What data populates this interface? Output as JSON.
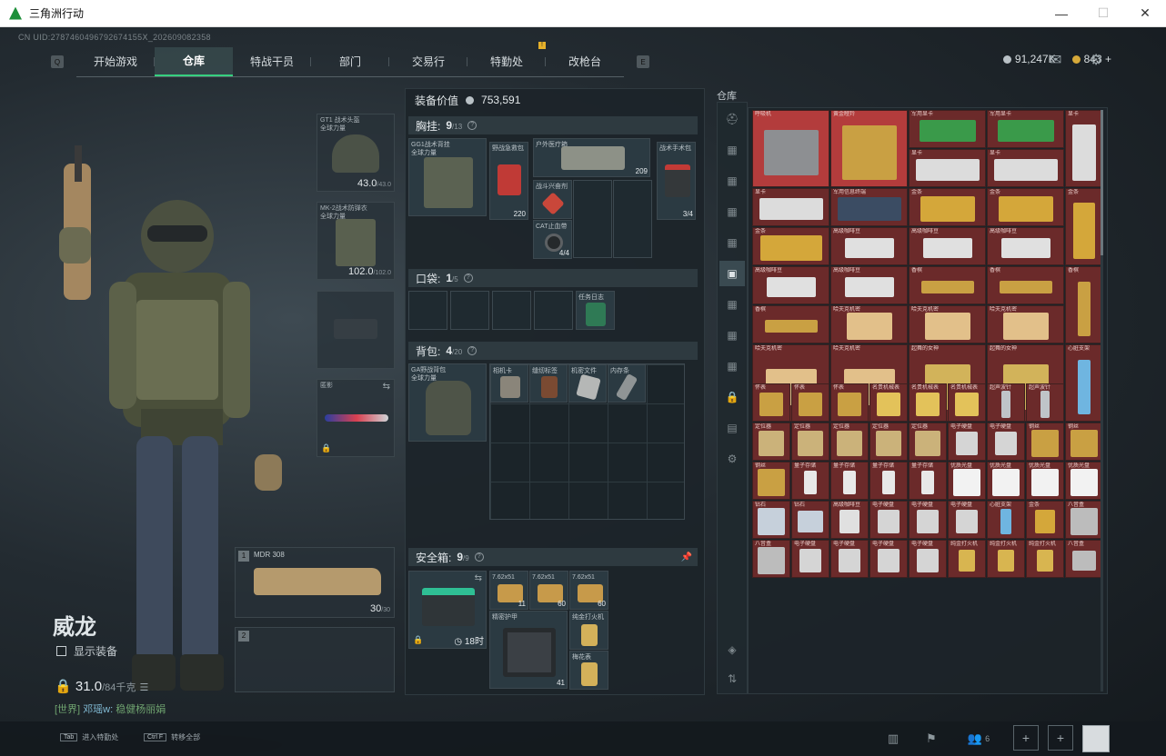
{
  "window": {
    "title": "三角洲行动",
    "minimize": "—",
    "maximize": "☐",
    "close": "✕"
  },
  "uid": "CN UID:2787460496792674155Ⅹ_2026090823​58",
  "nav": {
    "tabs": [
      {
        "label": "开始游戏"
      },
      {
        "label": "仓库",
        "active": true
      },
      {
        "label": "特战干员"
      },
      {
        "label": "部门"
      },
      {
        "label": "交易行"
      },
      {
        "label": "特勤处",
        "badge": "!"
      },
      {
        "label": "改枪台"
      }
    ],
    "left_key": "Q",
    "right_key": "E"
  },
  "currency": {
    "silver": "91,247K",
    "gold": "843",
    "plus": "+"
  },
  "character": {
    "name": "威龙",
    "show_equipment": "显示装备",
    "weight": "31.0",
    "weight_max": "/84千克",
    "chat_channel": "[世界]",
    "chat_text": "稳健杨丽娟",
    "chat_user": "邓瑶w: "
  },
  "equipment": {
    "helmet": {
      "label": "GT1 战术头盔",
      "sub": "全球力量",
      "dur": "43.0",
      "dur_max": "/43.0"
    },
    "armor": {
      "label": "MK-2战术防弹衣",
      "sub": "全球力量",
      "dur": "102.0",
      "dur_max": "/102.0"
    },
    "melee": {
      "label": "匿影"
    }
  },
  "weapons": [
    {
      "num": "1",
      "label": "MDR 308",
      "ammo": "30",
      "ammo_max": "/30"
    },
    {
      "num": "2",
      "label": ""
    }
  ],
  "loadout": {
    "value_label": "装备价值",
    "value": "753,591",
    "chest": {
      "title": "胸挂:",
      "count": "9",
      "cap": "/13",
      "rig": "GG1战术背挂",
      "rig_sub": "全球力量",
      "items": [
        {
          "name": "野战急救包",
          "val": "220"
        },
        {
          "name": "户外医疗箱",
          "val": "209"
        },
        {
          "name": "战术手术包",
          "val": "3/4"
        },
        {
          "name": "战斗兴奋剂",
          "val": ""
        },
        {
          "name": "CAT止血带",
          "val": "4/4"
        }
      ]
    },
    "pocket": {
      "title": "口袋:",
      "count": "1",
      "cap": "/5",
      "items": [
        {
          "name": "任务日志"
        }
      ]
    },
    "backpack": {
      "title": "背包:",
      "count": "4",
      "cap": "/20",
      "bag": "GA野战背包",
      "bag_sub": "全球力量",
      "items": [
        {
          "name": "相机卡"
        },
        {
          "name": "缝纫标签"
        },
        {
          "name": "机密文件"
        },
        {
          "name": "内存条"
        }
      ]
    },
    "safe": {
      "title": "安全箱:",
      "count": "9",
      "cap": "/9",
      "timer": "18时",
      "items": [
        {
          "name": "7.62x51",
          "val": "11"
        },
        {
          "name": "7.62x51",
          "val": "60"
        },
        {
          "name": "7.62x51",
          "val": "60"
        },
        {
          "name": "精密护甲",
          "val": "41"
        },
        {
          "name": "纯金打火机",
          "val": ""
        },
        {
          "name": "梅花表",
          "val": ""
        }
      ]
    }
  },
  "stash": {
    "title": "仓库",
    "cells": [
      {
        "name": "呼吸机",
        "color": "#b33c3c",
        "icon_color": "#8d8f92"
      },
      {
        "name": "黄金瞪羚",
        "color": "#b33c3c",
        "icon_color": "#c9a043"
      },
      {
        "name": "军用显卡",
        "color": "#6b2a2a",
        "icon_color": "#3a9a4a"
      },
      {
        "name": "军用显卡",
        "color": "#6b2a2a",
        "icon_color": "#3a9a4a"
      },
      {
        "name": "显卡",
        "color": "#6b2a2a",
        "icon_color": "#dcdcdc"
      },
      {
        "name": "显卡",
        "color": "#6b2a2a",
        "icon_color": "#dcdcdc"
      },
      {
        "name": "显卡",
        "color": "#6b2a2a",
        "icon_color": "#dcdcdc"
      },
      {
        "name": "军用信息终端",
        "color": "#6b2a2a",
        "icon_color": "#3b4c63"
      },
      {
        "name": "金条",
        "color": "#6b2a2a",
        "icon_color": "#d4a73a"
      },
      {
        "name": "金条",
        "color": "#6b2a2a",
        "icon_color": "#d4a73a"
      },
      {
        "name": "金条",
        "color": "#6b2a2a",
        "icon_color": "#d4a73a"
      },
      {
        "name": "金条",
        "color": "#6b2a2a",
        "icon_color": "#d4a73a"
      },
      {
        "name": "高级咖啡豆",
        "color": "#6b2a2a",
        "icon_color": "#e0e0e0"
      },
      {
        "name": "高级咖啡豆",
        "color": "#6b2a2a",
        "icon_color": "#e0e0e0"
      },
      {
        "name": "高级咖啡豆",
        "color": "#6b2a2a",
        "icon_color": "#e0e0e0"
      },
      {
        "name": "香槟",
        "color": "#6b2a2a",
        "icon_color": "#c9a043"
      },
      {
        "name": "哈夫克机密",
        "color": "#6b2a2a",
        "icon_color": "#e2c08a"
      },
      {
        "name": "起舞的女神",
        "color": "#6b2a2a",
        "icon_color": "#d2b35a"
      },
      {
        "name": "心脏支架",
        "color": "#6b2a2a",
        "icon_color": "#6fb5e0"
      },
      {
        "name": "怀表",
        "color": "#6b2a2a",
        "icon_color": "#c9a043"
      },
      {
        "name": "名贵机械表",
        "color": "#6b2a2a",
        "icon_color": "#e3c25a"
      },
      {
        "name": "超声波针",
        "color": "#6b2a2a",
        "icon_color": "#bfc4c8"
      },
      {
        "name": "定位器",
        "color": "#6b2a2a",
        "icon_color": "#cbb27a"
      },
      {
        "name": "电子硬盘",
        "color": "#6b2a2a",
        "icon_color": "#d5d5d5"
      },
      {
        "name": "钢丝",
        "color": "#6b2a2a",
        "icon_color": "#c9a043"
      },
      {
        "name": "量子存储",
        "color": "#6b2a2a",
        "icon_color": "#e8e8e8"
      },
      {
        "name": "优质光盘",
        "color": "#6b2a2a",
        "icon_color": "#f2f2f2"
      },
      {
        "name": "钻石",
        "color": "#6b2a2a",
        "icon_color": "#c6d0db"
      },
      {
        "name": "纯金打火机",
        "color": "#6b2a2a",
        "icon_color": "#d8b550"
      },
      {
        "name": "八音盒",
        "color": "#6b2a2a",
        "icon_color": "#bcbcbc"
      }
    ]
  },
  "bottom": {
    "hotkey1_key": "Tab",
    "hotkey1_label": "进入特勤处",
    "hotkey2_key": "Ctrl F",
    "hotkey2_label": "转移全部",
    "friends": "6"
  }
}
